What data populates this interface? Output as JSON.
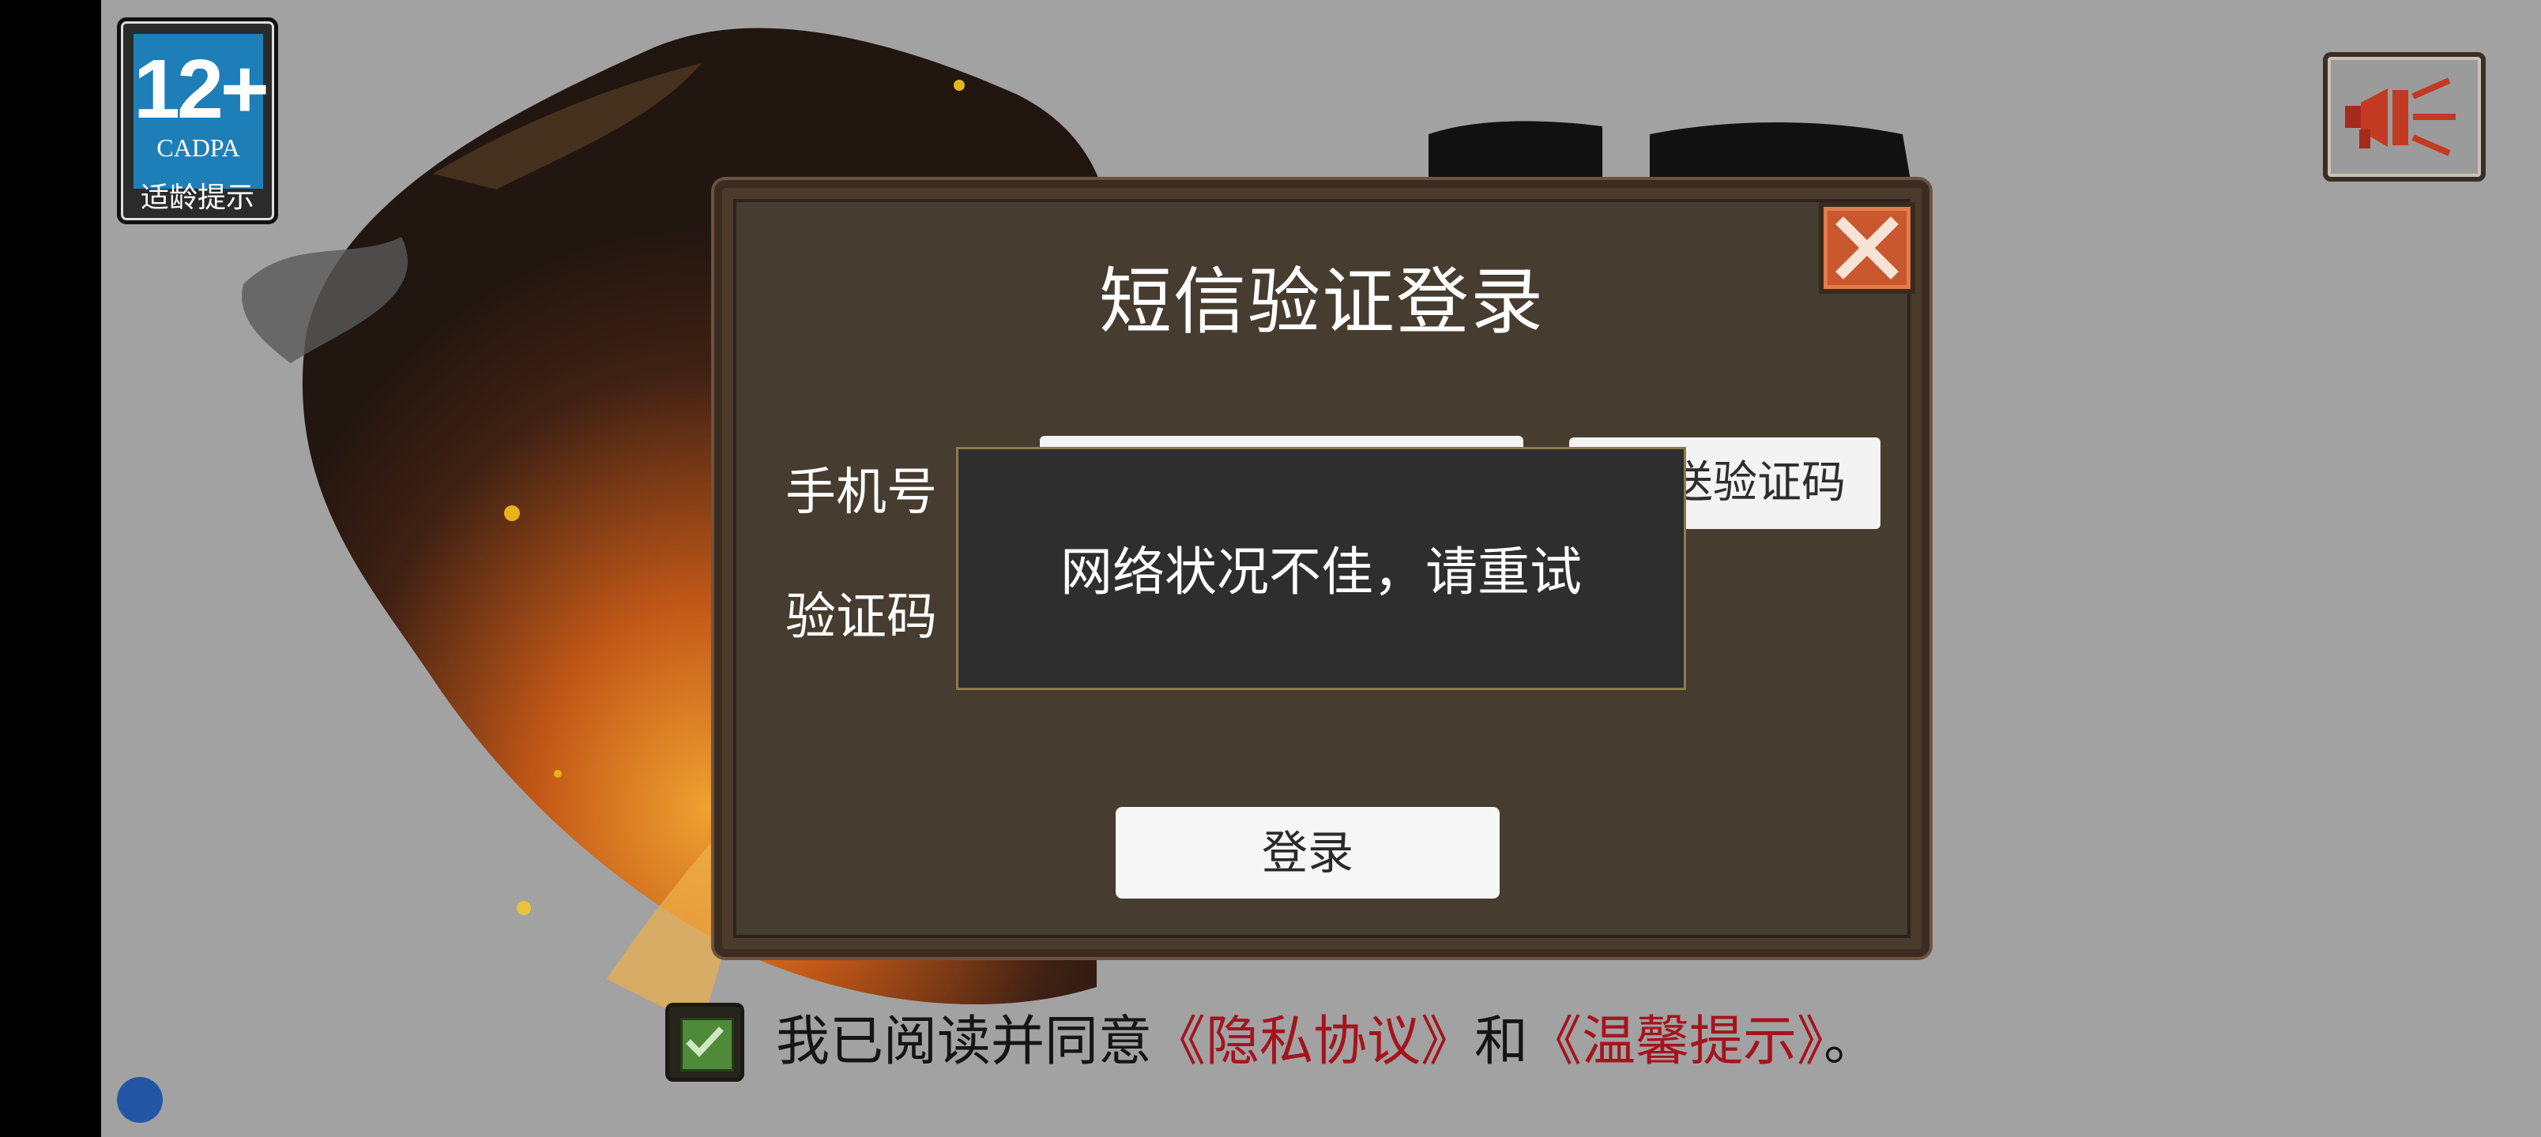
{
  "age_badge": {
    "age": "12+",
    "org": "CADPA",
    "tip": "适龄提示"
  },
  "dialog": {
    "title": "短信验证登录",
    "phone_label": "手机号",
    "code_label": "验证码",
    "send_code_label": "送验证码",
    "login_label": "登录"
  },
  "toast": {
    "message": "网络状况不佳，请重试"
  },
  "agreement": {
    "prefix": "我已阅读并同意",
    "privacy_link": "《隐私协议》",
    "and": "和",
    "tips_link": "《温馨提示》",
    "suffix": "。",
    "checked": true
  },
  "icons": {
    "sound": "speaker-mute-icon",
    "close": "close-icon",
    "check": "checkmark-icon"
  },
  "colors": {
    "dialog_bg": "#463c2f",
    "close_btn": "#c9582e",
    "link": "#a5141d",
    "badge_blue": "#1e7fb8",
    "checkbox": "#4e8a3a"
  }
}
